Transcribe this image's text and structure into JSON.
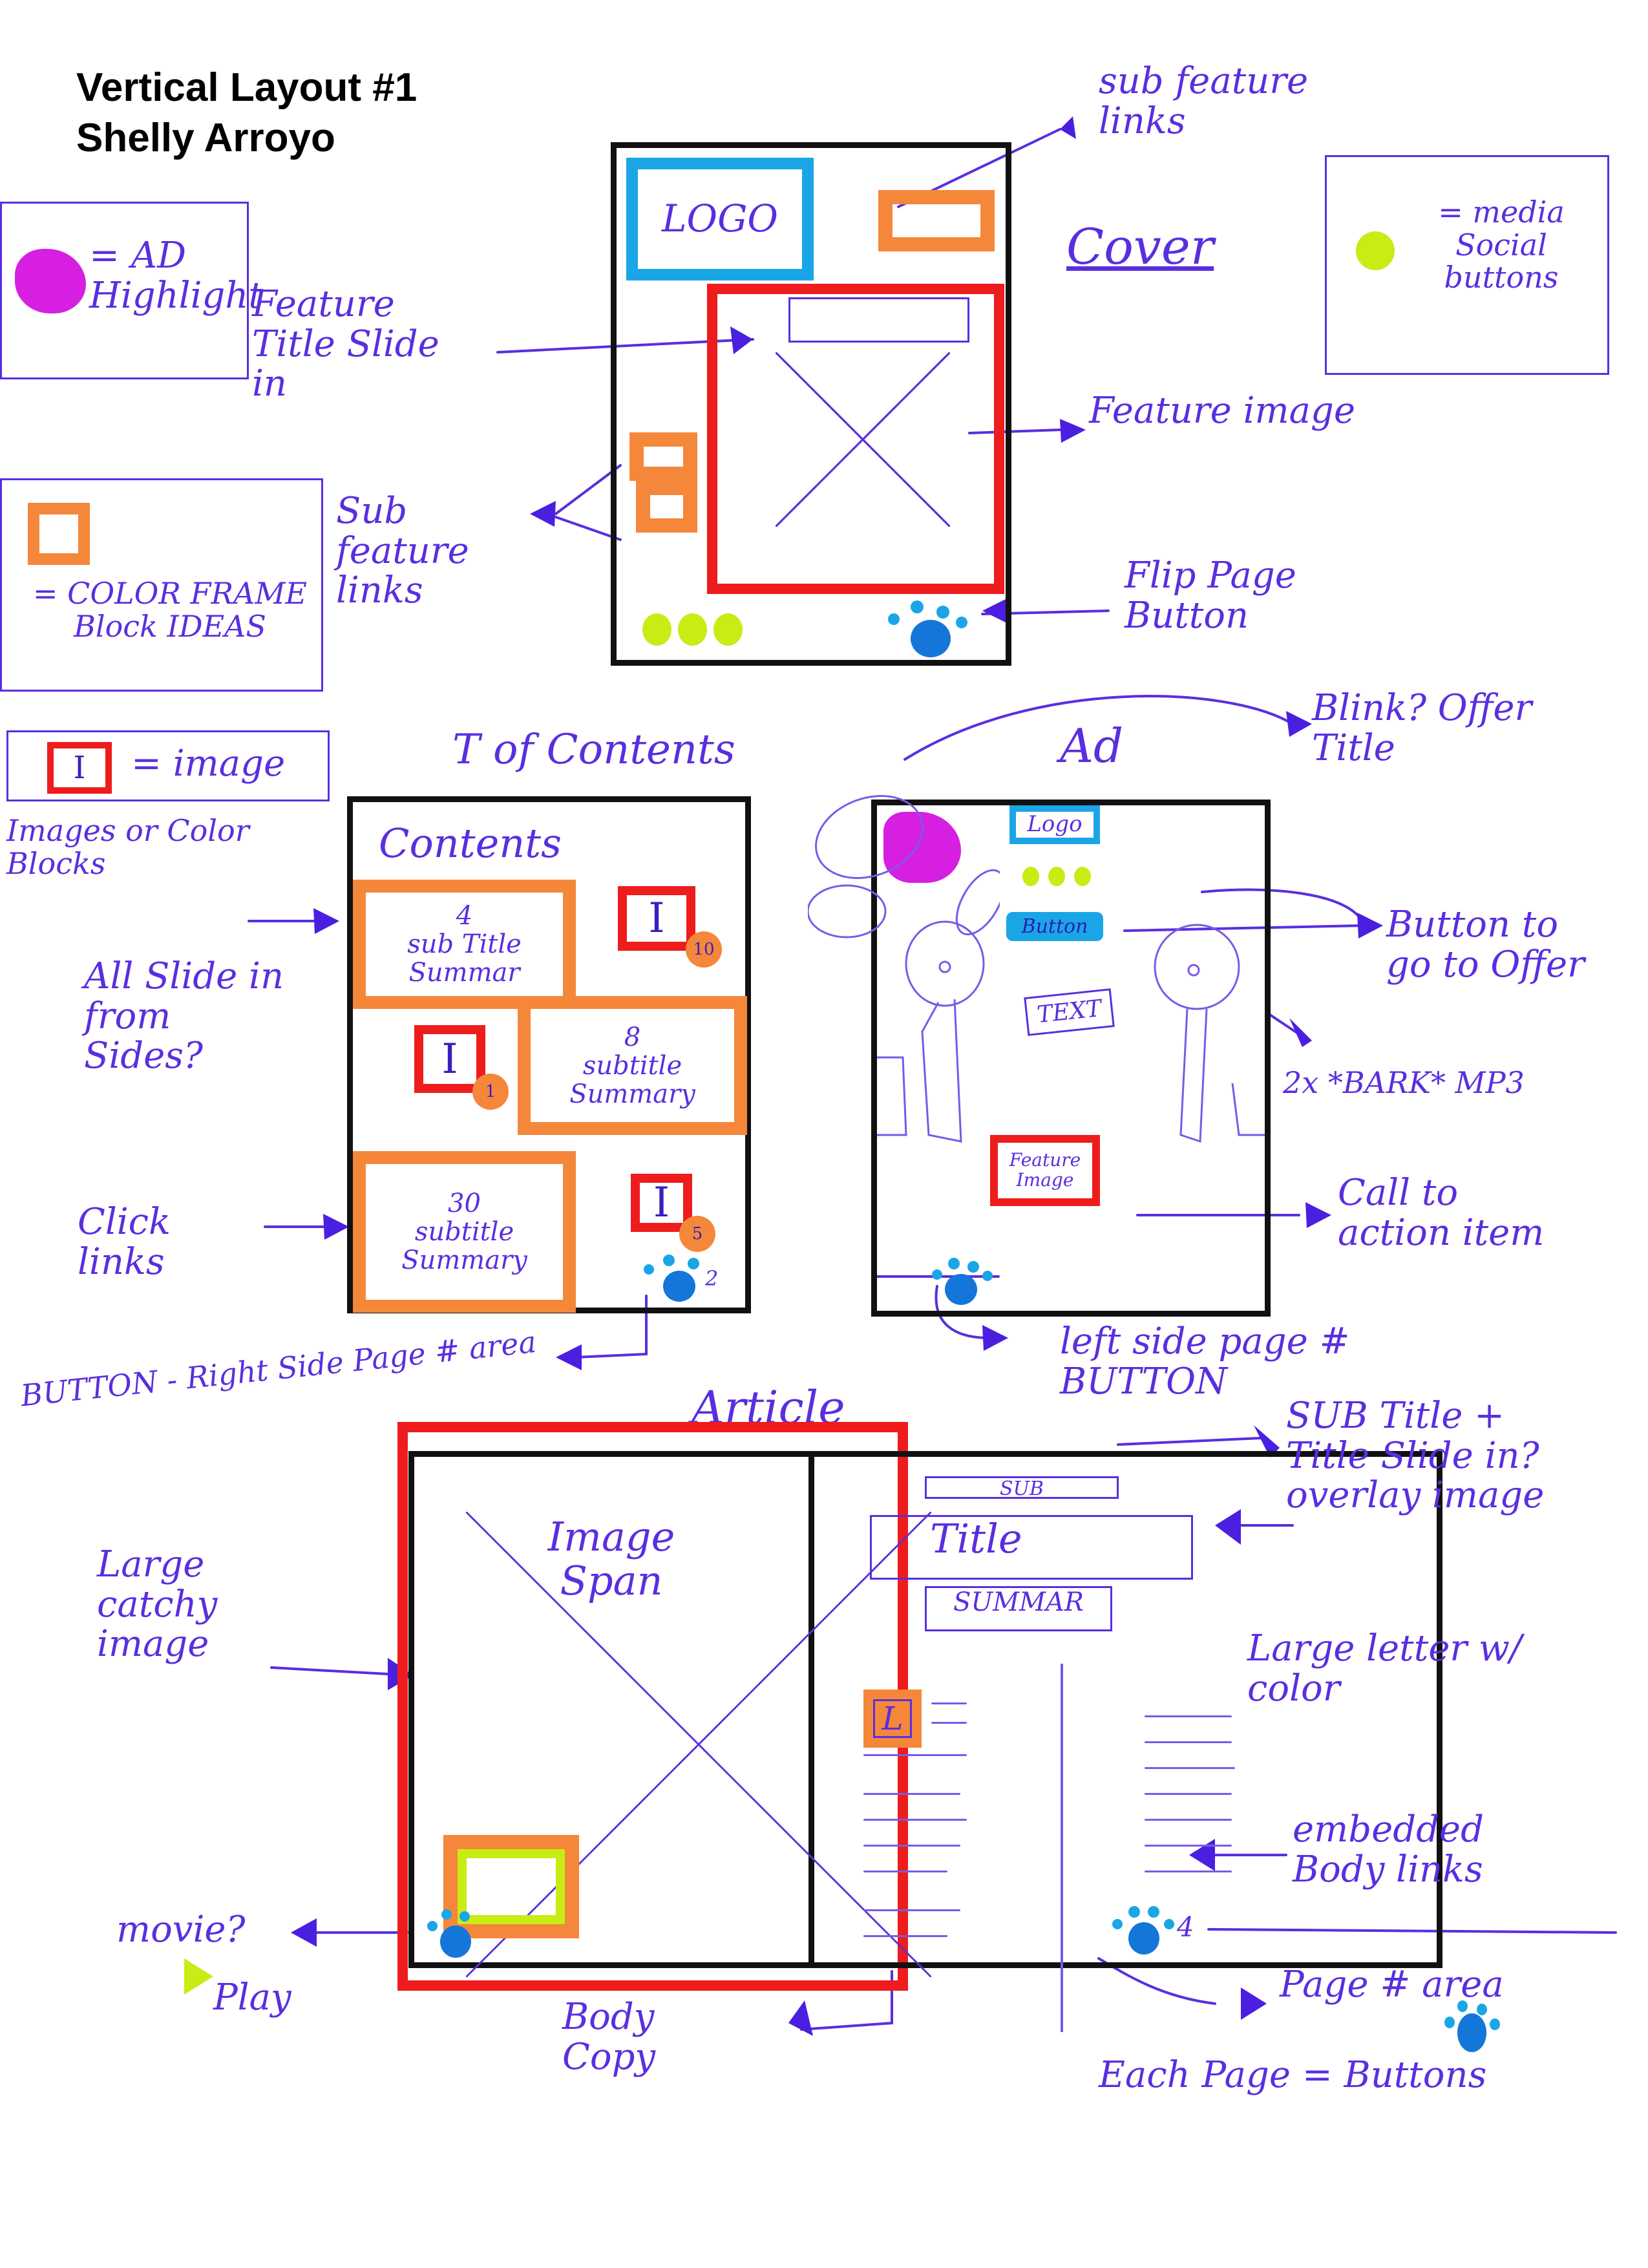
{
  "header": {
    "title": "Vertical Layout #1",
    "author": "Shelly Arroyo"
  },
  "legend": {
    "ad_highlight": "= AD Highlight",
    "color_frame": "= COLOR FRAME Block IDEAS",
    "social": "= media Social buttons",
    "image": "= image",
    "images_note": "Images or Color Blocks"
  },
  "colors": {
    "pen": "#5a2ee0",
    "frame": "#111111",
    "red": "#ee1c1c",
    "orange": "#f5873a",
    "cyan": "#1aa6e6",
    "lime": "#c9ec14",
    "magenta": "#d61fe0",
    "paw": "#1476d9"
  },
  "cover": {
    "section_label": "Cover",
    "logo": "LOGO",
    "annotations": {
      "sub_feature_links_top": "sub feature links",
      "feature_title": "Feature Title Slide in",
      "feature_image": "Feature image",
      "sub_feature_links_left": "Sub feature links",
      "flip_page": "Flip Page Button"
    }
  },
  "toc": {
    "section_label": "T of Contents",
    "heading": "Contents",
    "entries": [
      {
        "page": "4",
        "text": "sub Title Summar"
      },
      {
        "page": "8",
        "text": "subtitle Summary"
      },
      {
        "page": "30",
        "text": "subtitle Summary"
      }
    ],
    "image_glyph": "I",
    "badges": [
      "10",
      "1",
      "5"
    ],
    "page_number": "2",
    "annotations": {
      "slide_in": "All Slide in from Sides?",
      "click_links": "Click links",
      "button_area": "BUTTON - Right Side Page # area"
    }
  },
  "ad": {
    "section_label": "Ad",
    "logo": "Logo",
    "button": "Button",
    "text": "TEXT",
    "feature_image": "Feature Image",
    "annotations": {
      "blink": "Blink? Offer Title",
      "button_offer": "Button to go to Offer",
      "bark": "2x *BARK* MP3",
      "cta": "Call to action item",
      "left_page_button": "left side page # BUTTON"
    }
  },
  "article": {
    "section_label": "Article",
    "image_span": "Image Span",
    "sub": "SUB",
    "title": "Title",
    "summary": "SUMMAR",
    "drop_cap": "L",
    "page_number": "4",
    "annotations": {
      "sub_title": "SUB Title + Title Slide in? overlay image",
      "large_catchy": "Large catchy image",
      "large_letter": "Large letter w/ color",
      "embedded": "embedded Body links",
      "movie": "movie?",
      "play": "Play",
      "body_copy": "Body Copy",
      "page_area": "Page # area",
      "each_page": "Each Page = Buttons"
    }
  }
}
